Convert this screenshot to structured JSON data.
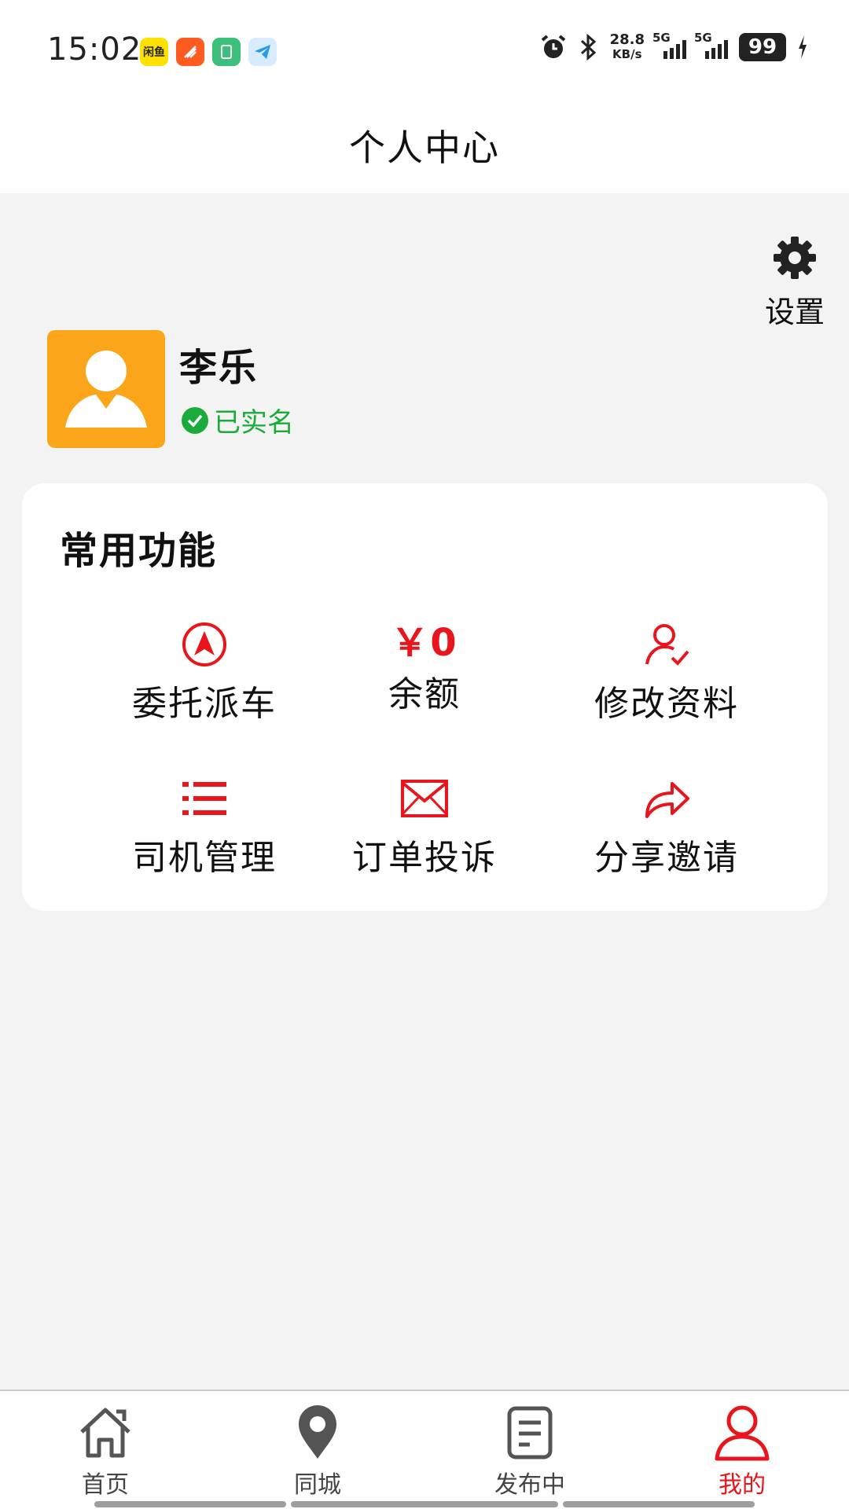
{
  "status_bar": {
    "time": "15:02",
    "apps": [
      "闲鱼",
      "",
      "",
      ""
    ],
    "net_speed_value": "28.8",
    "net_speed_unit": "KB/s",
    "sim1": "5G",
    "sim2": "5G",
    "battery": "99"
  },
  "header": {
    "title": "个人中心"
  },
  "settings": {
    "label": "设置",
    "icon": "gear-icon"
  },
  "profile": {
    "name": "李乐",
    "verified_label": "已实名",
    "avatar_color": "#fba61a"
  },
  "functions": {
    "title": "常用功能",
    "balance_value": "￥0",
    "items": [
      {
        "label": "委托派车",
        "icon": "navigation-arrow-icon"
      },
      {
        "label": "余额",
        "icon": "balance"
      },
      {
        "label": "修改资料",
        "icon": "user-edit-icon"
      },
      {
        "label": "司机管理",
        "icon": "list-icon"
      },
      {
        "label": "订单投诉",
        "icon": "envelope-icon"
      },
      {
        "label": "分享邀请",
        "icon": "share-arrow-icon"
      }
    ]
  },
  "bottom_nav": {
    "items": [
      {
        "label": "首页",
        "icon": "home-icon"
      },
      {
        "label": "同城",
        "icon": "location-pin-icon"
      },
      {
        "label": "发布中",
        "icon": "document-icon"
      },
      {
        "label": "我的",
        "icon": "user-icon"
      }
    ],
    "active_index": 3
  },
  "colors": {
    "accent": "#e8151c",
    "verified": "#1aab3a",
    "background": "#f3f3f3"
  }
}
